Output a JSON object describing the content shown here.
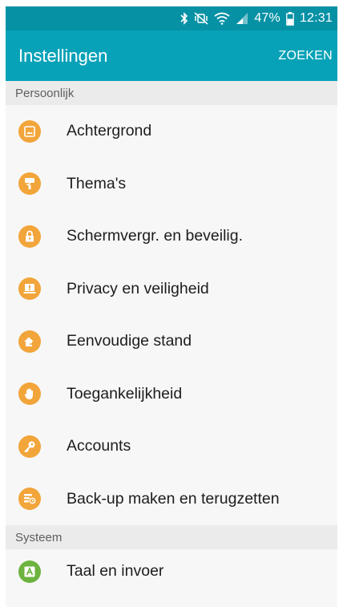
{
  "status_bar": {
    "battery_text": "47%",
    "time": "12:31",
    "icons": [
      "bluetooth-icon",
      "mute-vibrate-icon",
      "wifi-icon",
      "signal-icon",
      "battery-icon"
    ]
  },
  "app_bar": {
    "title": "Instellingen",
    "action_label": "ZOEKEN"
  },
  "sections": [
    {
      "header": "Persoonlijk",
      "items": [
        {
          "label": "Achtergrond",
          "icon": "wallpaper-icon",
          "color": "#f2a53a"
        },
        {
          "label": "Thema's",
          "icon": "paint-roller-icon",
          "color": "#f2a53a"
        },
        {
          "label": "Schermvergr. en beveilig.",
          "icon": "lock-icon",
          "color": "#f2a53a"
        },
        {
          "label": "Privacy en veiligheid",
          "icon": "privacy-alert-icon",
          "color": "#f2a53a"
        },
        {
          "label": "Eenvoudige stand",
          "icon": "easy-mode-home-icon",
          "color": "#f2a53a"
        },
        {
          "label": "Toegankelijkheid",
          "icon": "hand-icon",
          "color": "#f2a53a"
        },
        {
          "label": "Accounts",
          "icon": "key-icon",
          "color": "#f2a53a"
        },
        {
          "label": "Back-up maken en terugzetten",
          "icon": "backup-restore-icon",
          "color": "#f2a53a"
        }
      ]
    },
    {
      "header": "Systeem",
      "items": [
        {
          "label": "Taal en invoer",
          "icon": "language-input-icon",
          "color": "#6cb33f"
        }
      ]
    }
  ],
  "colors": {
    "status_bar": "#0691a5",
    "app_bar": "#07a2b8",
    "section_header_bg": "#ebebeb",
    "list_bg": "#f7f7f7"
  }
}
